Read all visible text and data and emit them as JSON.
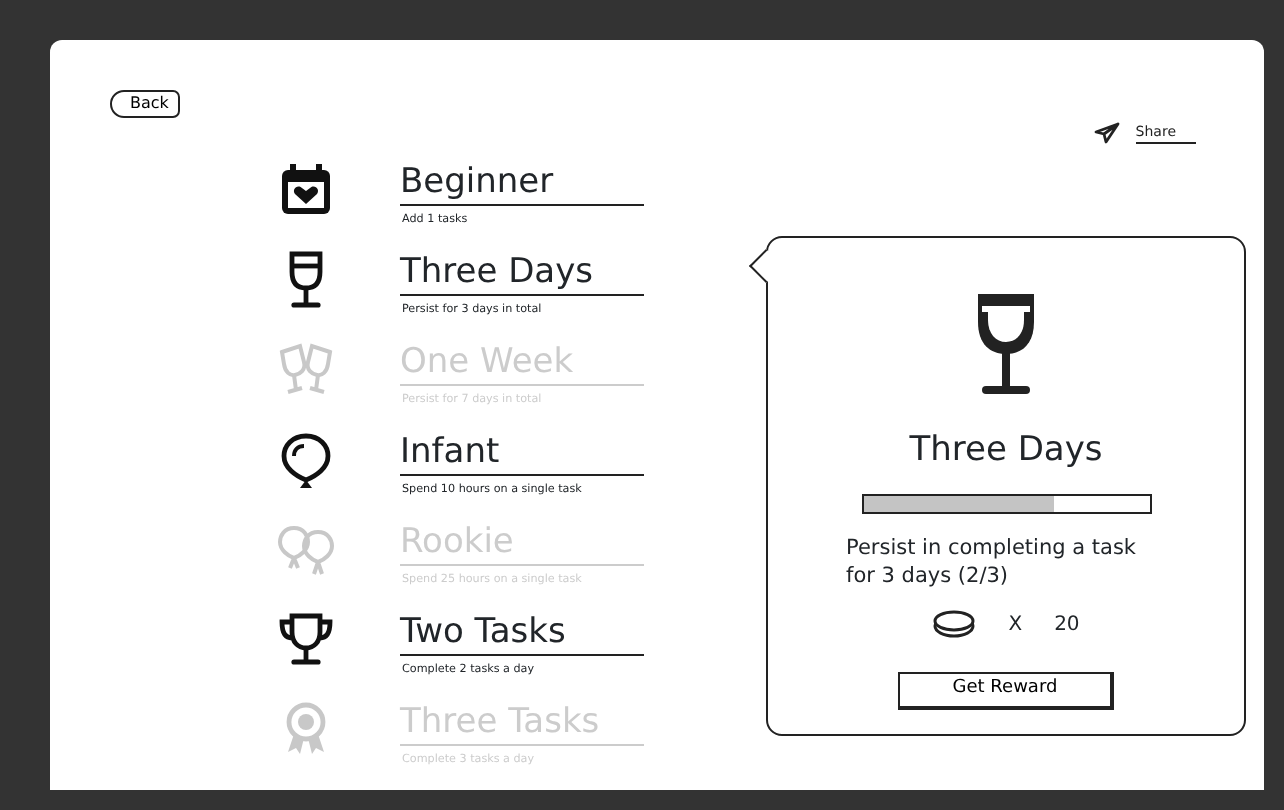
{
  "header": {
    "back": "Back",
    "share": "Share"
  },
  "achievements": [
    {
      "title": "Beginner",
      "description": "Add 1 tasks",
      "unlocked": true
    },
    {
      "title": "Three Days",
      "description": "Persist for 3 days in total",
      "unlocked": true
    },
    {
      "title": "One Week",
      "description": "Persist for 7 days in total",
      "unlocked": false
    },
    {
      "title": "Infant",
      "description": "Spend 10 hours on a single task",
      "unlocked": true
    },
    {
      "title": "Rookie",
      "description": "Spend 25 hours on a single task",
      "unlocked": false
    },
    {
      "title": "Two Tasks",
      "description": "Complete 2 tasks a day",
      "unlocked": true
    },
    {
      "title": "Three Tasks",
      "description": "Complete 3 tasks a day",
      "unlocked": false
    }
  ],
  "detail": {
    "title": "Three Days",
    "level": 0.67,
    "description": "Persist in completing a task for 3 days (2/3)",
    "multiplier": "X",
    "reward": "20",
    "button": "Get Reward"
  }
}
